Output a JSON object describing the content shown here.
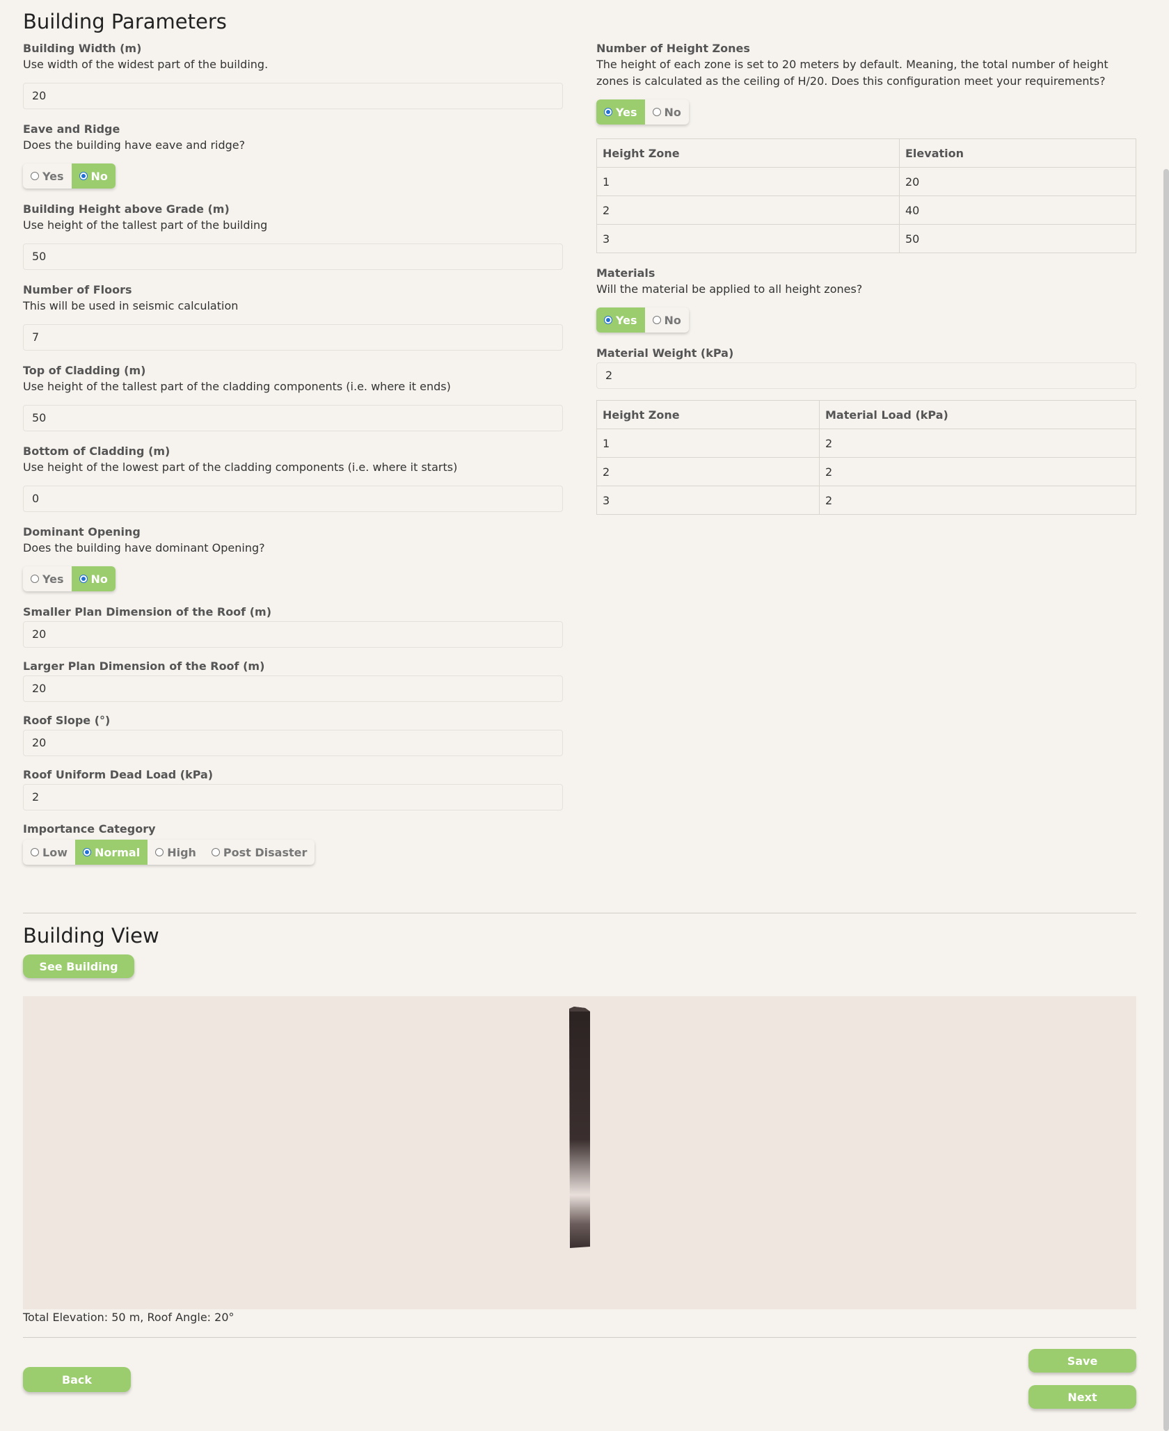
{
  "headings": {
    "parameters": "Building Parameters",
    "view": "Building View"
  },
  "left": {
    "building_width": {
      "label": "Building Width (m)",
      "desc": "Use width of the widest part of the building.",
      "value": "20"
    },
    "eave_ridge": {
      "label": "Eave and Ridge",
      "desc": "Does the building have eave and ridge?",
      "options": [
        "Yes",
        "No"
      ],
      "selected": "No"
    },
    "building_height": {
      "label": "Building Height above Grade (m)",
      "desc": "Use height of the tallest part of the building",
      "value": "50"
    },
    "floors": {
      "label": "Number of Floors",
      "desc": "This will be used in seismic calculation",
      "value": "7"
    },
    "top_cladding": {
      "label": "Top of Cladding (m)",
      "desc": "Use height of the tallest part of the cladding components (i.e. where it ends)",
      "value": "50"
    },
    "bottom_cladding": {
      "label": "Bottom of Cladding (m)",
      "desc": "Use height of the lowest part of the cladding components (i.e. where it starts)",
      "value": "0"
    },
    "dominant_opening": {
      "label": "Dominant Opening",
      "desc": "Does the building have dominant Opening?",
      "options": [
        "Yes",
        "No"
      ],
      "selected": "No"
    },
    "smaller_plan": {
      "label": "Smaller Plan Dimension of the Roof (m)",
      "value": "20"
    },
    "larger_plan": {
      "label": "Larger Plan Dimension of the Roof (m)",
      "value": "20"
    },
    "roof_slope": {
      "label": "Roof Slope (°)",
      "value": "20"
    },
    "roof_dead_load": {
      "label": "Roof Uniform Dead Load (kPa)",
      "value": "2"
    },
    "importance": {
      "label": "Importance Category",
      "options": [
        "Low",
        "Normal",
        "High",
        "Post Disaster"
      ],
      "selected": "Normal"
    }
  },
  "right": {
    "height_zones": {
      "label": "Number of Height Zones",
      "desc": "The height of each zone is set to 20 meters by default. Meaning, the total number of height zones is calculated as the ceiling of H/20. Does this configuration meet your requirements?",
      "options": [
        "Yes",
        "No"
      ],
      "selected": "Yes",
      "headers": [
        "Height Zone",
        "Elevation"
      ],
      "rows": [
        [
          "1",
          "20"
        ],
        [
          "2",
          "40"
        ],
        [
          "3",
          "50"
        ]
      ]
    },
    "materials": {
      "label": "Materials",
      "desc": "Will the material be applied to all height zones?",
      "options": [
        "Yes",
        "No"
      ],
      "selected": "Yes"
    },
    "material_weight": {
      "label": "Material Weight (kPa)",
      "value": "2"
    },
    "material_table": {
      "headers": [
        "Height Zone",
        "Material Load (kPa)"
      ],
      "rows": [
        [
          "1",
          "2"
        ],
        [
          "2",
          "2"
        ],
        [
          "3",
          "2"
        ]
      ]
    }
  },
  "view": {
    "see_building": "See Building",
    "caption": "Total Elevation: 50 m, Roof Angle: 20°"
  },
  "footer": {
    "back": "Back",
    "save": "Save",
    "next": "Next"
  },
  "colors": {
    "accent": "#9bcc6d",
    "background": "#f6f3ee",
    "viewport": "#efe7df"
  }
}
